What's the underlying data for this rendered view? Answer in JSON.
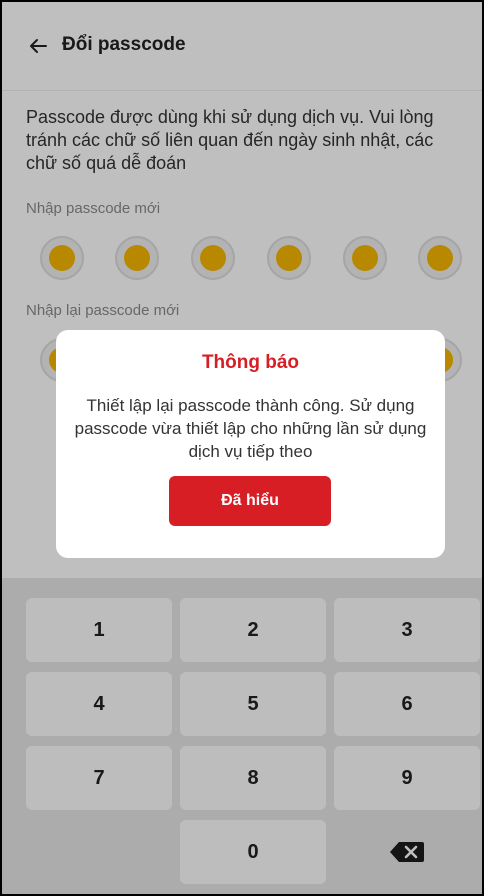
{
  "header": {
    "title": "Đổi passcode",
    "back_icon": "arrow-left-icon"
  },
  "description": "Passcode được dùng khi sử dụng dịch vụ. Vui lòng tránh các chữ số liên quan đến ngày sinh nhật, các chữ số quá dễ đoán",
  "new_passcode": {
    "label": "Nhập passcode mới",
    "length": 6,
    "filled": 6
  },
  "confirm_passcode": {
    "label": "Nhập lại passcode mới",
    "length": 6,
    "filled": 6
  },
  "dialog": {
    "title": "Thông báo",
    "message": "Thiết lập lại passcode thành công. Sử dụng passcode vừa thiết lập cho những lần sử dụng dịch vụ tiếp theo",
    "button_label": "Đã hiểu"
  },
  "keypad": {
    "keys": [
      "1",
      "2",
      "3",
      "4",
      "5",
      "6",
      "7",
      "8",
      "9",
      "",
      "0",
      "backspace"
    ],
    "delete_icon": "backspace-icon"
  },
  "colors": {
    "accent": "#d81e25",
    "dot_fill": "#f6b700",
    "keypad_bg": "#e6e6e6"
  }
}
